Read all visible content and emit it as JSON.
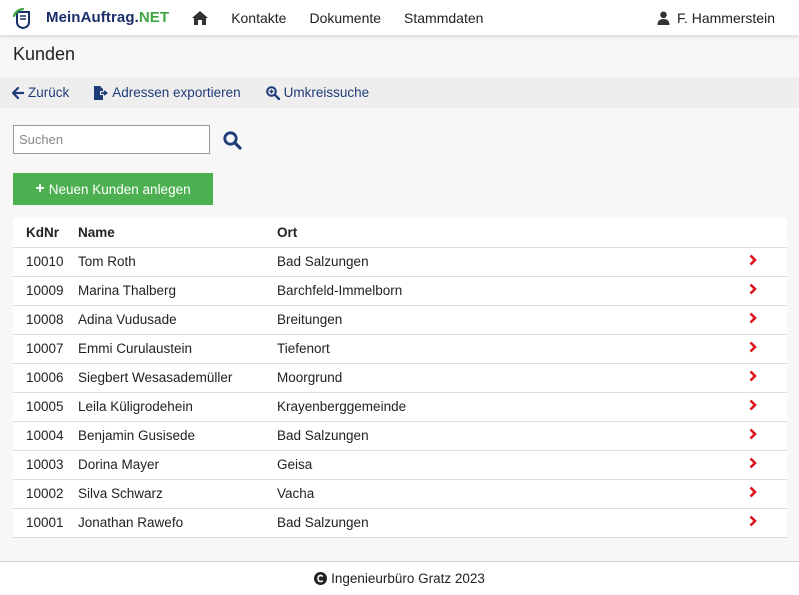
{
  "brand": {
    "main": "MeinAuftrag.",
    "net": "NET"
  },
  "nav": {
    "home_icon": "home-icon",
    "links": [
      "Kontakte",
      "Dokumente",
      "Stammdaten"
    ],
    "user": "F. Hammerstein"
  },
  "page": {
    "title": "Kunden"
  },
  "toolbar": {
    "back": "Zurück",
    "export": "Adressen exportieren",
    "radius": "Umkreissuche"
  },
  "search": {
    "placeholder": "Suchen",
    "value": ""
  },
  "actions": {
    "add_customer": "Neuen Kunden anlegen"
  },
  "table": {
    "headers": [
      "KdNr",
      "Name",
      "Ort"
    ],
    "rows": [
      [
        "10010",
        "Tom Roth",
        "Bad Salzungen"
      ],
      [
        "10009",
        "Marina Thalberg",
        "Barchfeld-Immelborn"
      ],
      [
        "10008",
        "Adina Vudusade",
        "Breitungen"
      ],
      [
        "10007",
        "Emmi Curulaustein",
        "Tiefenort"
      ],
      [
        "10006",
        "Siegbert Wesasademüller",
        "Moorgrund"
      ],
      [
        "10005",
        "Leila Küligrodehein",
        "Krayenberggemeinde"
      ],
      [
        "10004",
        "Benjamin Gusisede",
        "Bad Salzungen"
      ],
      [
        "10003",
        "Dorina Mayer",
        "Geisa"
      ],
      [
        "10002",
        "Silva Schwarz",
        "Vacha"
      ],
      [
        "10001",
        "Jonathan Rawefo",
        "Bad Salzungen"
      ]
    ]
  },
  "footer": {
    "text": "Ingenieurbüro Gratz 2023"
  },
  "colors": {
    "brand_blue": "#1a2f6b",
    "brand_green": "#3aa63f",
    "link_blue": "#1f3c7a",
    "add_green": "#4caf50",
    "chevron_red": "#e0101b"
  }
}
